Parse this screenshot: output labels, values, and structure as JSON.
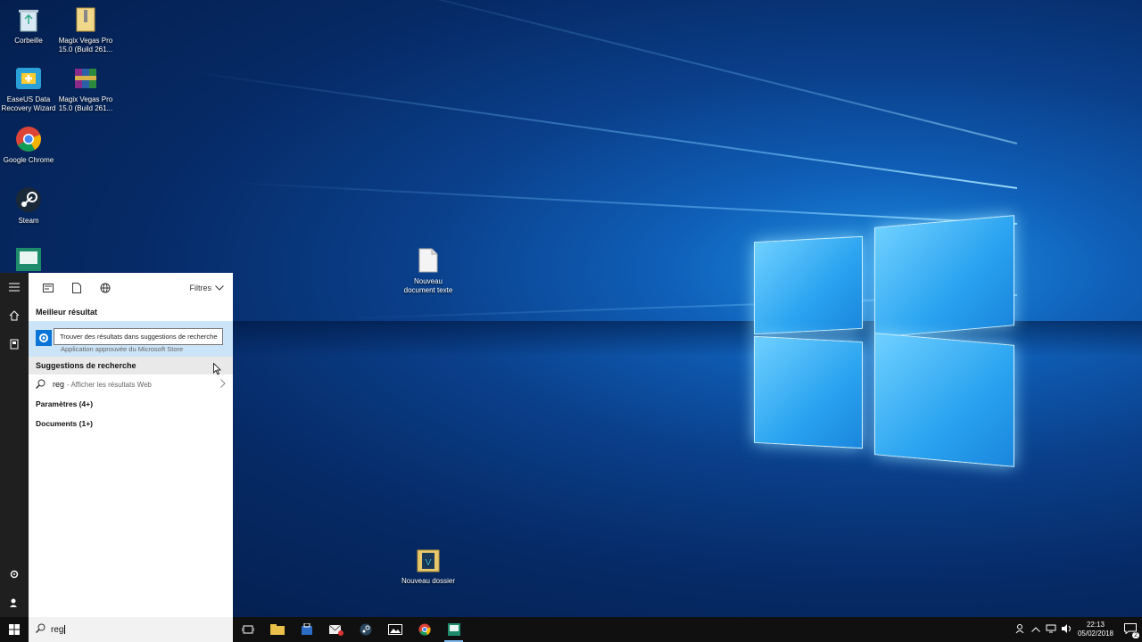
{
  "desktop": {
    "icons": [
      {
        "label": "Corbeille"
      },
      {
        "label": "Magix Vegas Pro 15.0 (Build 261..."
      },
      {
        "label": "EaseUS Data Recovery Wizard"
      },
      {
        "label": "Magix Vegas Pro 15.0 (Build 261..."
      },
      {
        "label": "Google Chrome"
      },
      {
        "label": "Steam"
      },
      {
        "label": "Nouveau document texte"
      },
      {
        "label": "Nouveau dossier"
      }
    ]
  },
  "search_panel": {
    "filters_label": "Filtres",
    "best_result_heading": "Meilleur résultat",
    "tooltip": "Trouver des résultats dans suggestions de recherche",
    "best_result_subtitle": "Application approuvée du Microsoft Store",
    "suggestions_heading": "Suggestions de recherche",
    "suggestion": {
      "query": "reg",
      "hint": "- Afficher les résultats Web"
    },
    "categories": [
      "Paramètres (4+)",
      "Documents (1+)"
    ]
  },
  "taskbar": {
    "search_value": "reg",
    "clock_time": "22:13",
    "clock_date": "05/02/2018",
    "notification_count": "2"
  },
  "colors": {
    "accent": "#0a74d8",
    "selection": "#cce4f7",
    "taskbar": "#101010"
  }
}
